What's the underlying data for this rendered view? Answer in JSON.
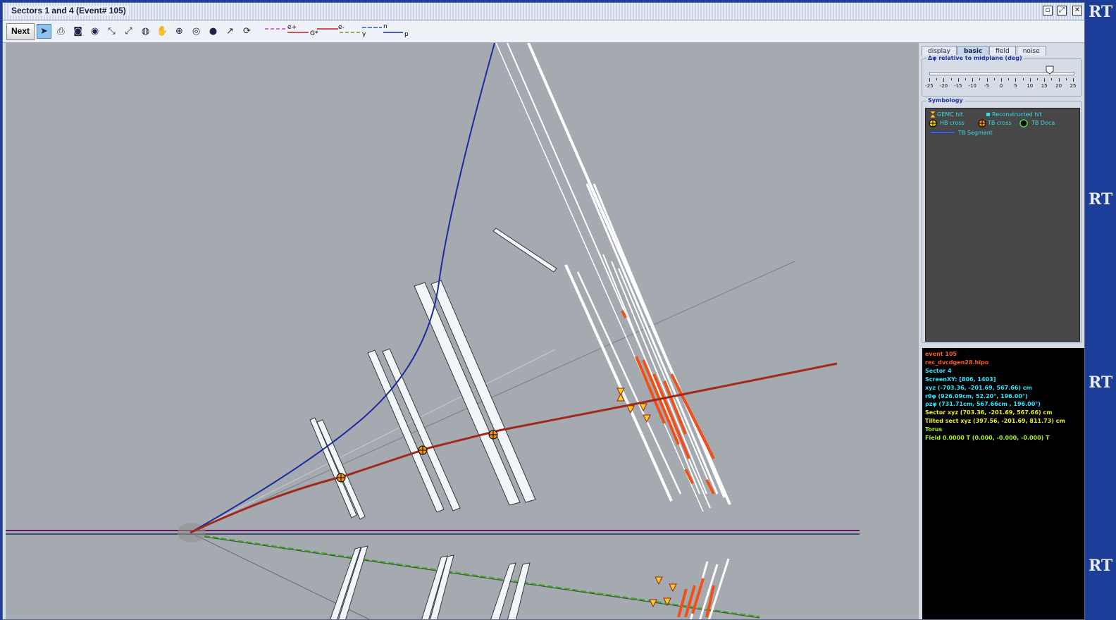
{
  "window": {
    "title": "Sectors 1 and 4  (Event# 105)",
    "controls": [
      "minimize-icon",
      "maximize-icon",
      "close-icon"
    ]
  },
  "toolbar": {
    "next_label": "Next",
    "tools": [
      "pointer-icon",
      "print-icon",
      "camera-icon",
      "world-refresh-icon",
      "shrink-icon",
      "expand-icon",
      "globe-icon",
      "pan-hand-icon",
      "zoom-icon",
      "world-icon",
      "world-green-icon",
      "arrow-icon",
      "refresh-page-icon"
    ],
    "particle_legend": [
      {
        "label": "e+",
        "color": "#d040d0"
      },
      {
        "label": "G*",
        "color": "#c02020"
      },
      {
        "label": "e-",
        "color": "#c02020"
      },
      {
        "label": "γ",
        "color": "#70a030"
      },
      {
        "label": "n",
        "color": "#3050c0"
      },
      {
        "label": "p",
        "color": "#1a2aa0"
      }
    ]
  },
  "side_panel": {
    "tabs": [
      "display",
      "basic",
      "field",
      "noise"
    ],
    "active_tab": "basic",
    "slider": {
      "title": "Δφ relative to midplane (deg)",
      "ticks": [
        "-25",
        "-20",
        "-15",
        "-10",
        "-5",
        "0",
        "5",
        "10",
        "15",
        "20",
        "25"
      ],
      "value": 17
    },
    "symbology": {
      "title": "Symbology",
      "items": [
        {
          "label": "GEMC hit",
          "icon": "gemc-hit-icon"
        },
        {
          "label": "Reconstructed hit",
          "icon": "reconstructed-hit-icon"
        },
        {
          "label": "HB cross",
          "icon": "hb-cross-icon"
        },
        {
          "label": "TB cross",
          "icon": "tb-cross-icon"
        },
        {
          "label": "TB Doca",
          "icon": "tb-doca-icon"
        },
        {
          "label": "TB Segment",
          "icon": "tb-segment-icon"
        }
      ]
    }
  },
  "info": {
    "lines": [
      {
        "text": "event 105",
        "color": "#ff5a1e"
      },
      {
        "text": "rec_dvcdgen28.hipo",
        "color": "#ff5a1e"
      },
      {
        "text": "Sector 4",
        "color": "#28e8ff"
      },
      {
        "text": "ScreenXY: [806, 1403]",
        "color": "#28e8ff"
      },
      {
        "text": "xyz (-703.36, -201.69, 567.66) cm",
        "color": "#28e8ff"
      },
      {
        "text": "rθφ (926.09cm, 52.20°, 196.00°)",
        "color": "#28e8ff"
      },
      {
        "text": "ρzφ (731.71cm, 567.66cm , 196.00°)",
        "color": "#28e8ff"
      },
      {
        "text": "Sector xyz (703.36, -201.69, 567.66) cm",
        "color": "#f0f020"
      },
      {
        "text": "Tilted sect xyz (397.56, -201.69, 811.73) cm",
        "color": "#f0f020"
      },
      {
        "text": "Torus",
        "color": "#a8f020"
      },
      {
        "text": "Field 0.0000 T (0.000, -0.000, -0.000) T",
        "color": "#a8f020"
      }
    ]
  },
  "background_strip": {
    "text": "RT"
  }
}
